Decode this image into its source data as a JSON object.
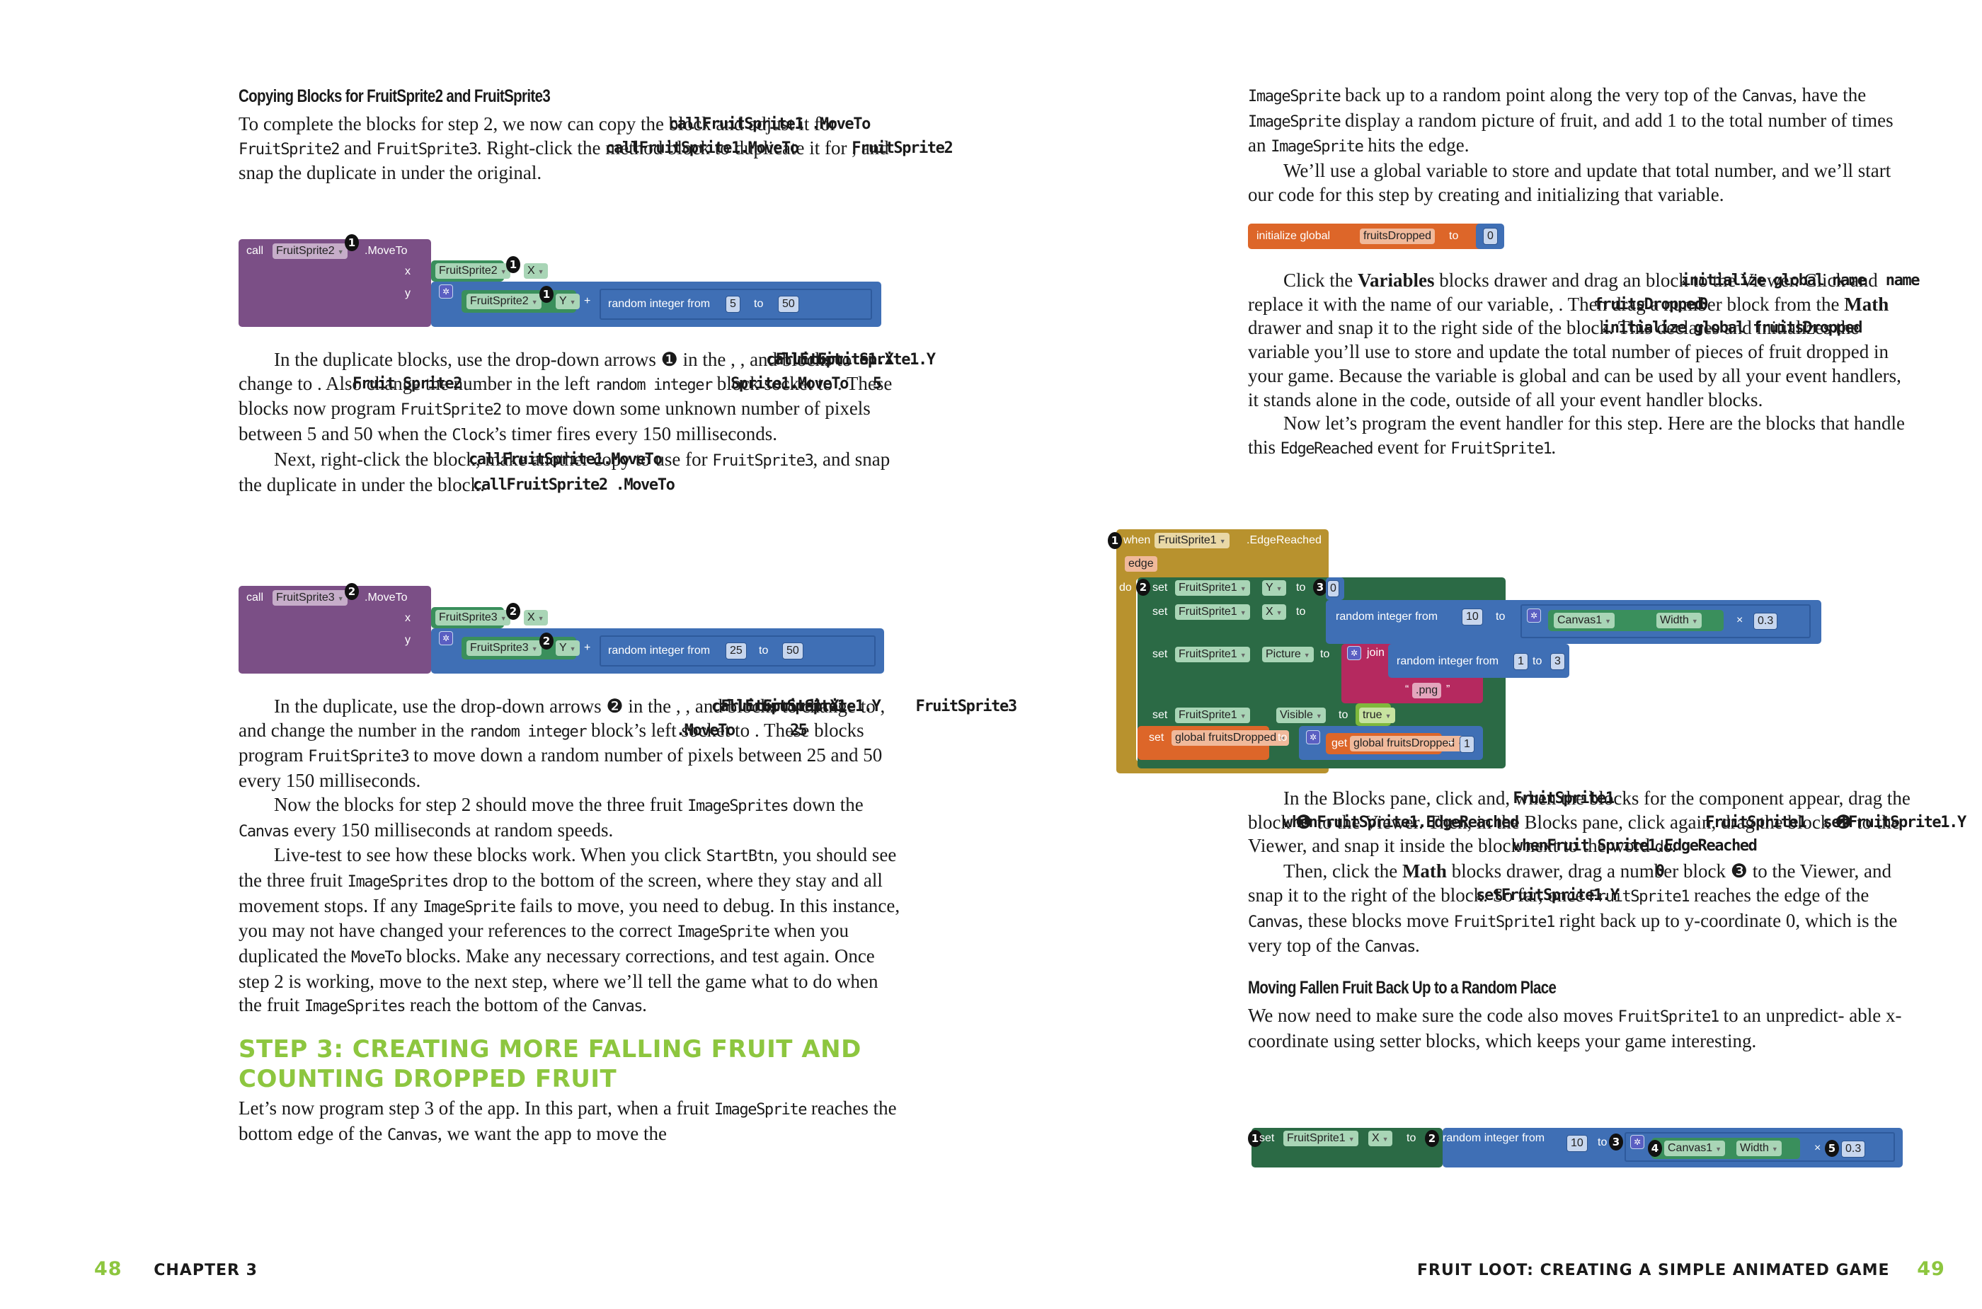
{
  "left_page": {
    "section_heading": "Copying Blocks for FruitSprite2 and FruitSprite3",
    "p1": [
      "To complete the blocks for step 2, we now can copy the ",
      "callFruitSprite1 .MoveTo",
      " block and adjust it for ",
      "FruitSprite2",
      " and ",
      "FruitSprite3",
      ". Right-click the ",
      "callFruitSprite1.MoveTo",
      " method block to duplicate it for ",
      "FruitSprite2",
      ", and snap the duplicate in under the original."
    ],
    "block1": {
      "call_label": "call",
      "component": "FruitSprite2",
      "method": ".MoveTo",
      "x_label": "x",
      "y_label": "y",
      "x_getter": {
        "component": "FruitSprite2",
        "prop": "X"
      },
      "y_getter": {
        "component": "FruitSprite2",
        "prop": "Y"
      },
      "plus": "+",
      "random_label": "random integer from",
      "to_label": "to",
      "from_value": "5",
      "to_value": "50",
      "callout": "1"
    },
    "p2": [
      "In the duplicate blocks, use the drop-down arrows ",
      "❶",
      " in the ",
      "callFruit Sprite1.MoveTo",
      ", ",
      "FruitSprite1.X",
      ", and ",
      "FruitSprite1.Y",
      " blocks to change to ",
      "Fruit Sprite2",
      ". Also change the number in the left ",
      "random integer",
      " block socket to ",
      "5",
      ". These blocks now program ",
      "FruitSprite2",
      " to move down some unknown number of pixels between 5 and 50 when the ",
      "Clock",
      "’s timer fires every 150 milliseconds."
    ],
    "p3": [
      "Next, right-click the ",
      "callFruitSprite1.MoveTo",
      " block, make another copy to use for ",
      "FruitSprite3",
      ", and snap the duplicate in under the ",
      "callFruitSprite2 .MoveTo",
      " block."
    ],
    "block2": {
      "call_label": "call",
      "component": "FruitSprite3",
      "method": ".MoveTo",
      "x_label": "x",
      "y_label": "y",
      "x_getter": {
        "component": "FruitSprite3",
        "prop": "X"
      },
      "y_getter": {
        "component": "FruitSprite3",
        "prop": "Y"
      },
      "plus": "+",
      "random_label": "random integer from",
      "to_label": "to",
      "from_value": "25",
      "to_value": "50",
      "callout": "2"
    },
    "p4": [
      "In the duplicate, use the drop-down arrows ",
      "❷",
      " in the ",
      "callFruitSprite1 .MoveTo",
      ", ",
      "FruitSprite1.X",
      ", and ",
      "FruitSprite1.Y",
      " blocks to change to ",
      "FruitSprite3",
      ", and change the number in the ",
      "random integer",
      " block’s left socket to ",
      "25",
      ". These blocks program ",
      "FruitSprite3",
      " to move down a random number of pixels between 25 and 50 every 150 milliseconds."
    ],
    "p5": [
      "Now the blocks for step 2 should move the three fruit ",
      "ImageSprites",
      " down the ",
      "Canvas",
      " every 150 milliseconds at random speeds."
    ],
    "p6": [
      "Live-test to see how these blocks work. When you click ",
      "StartBtn",
      ", you should see the three fruit ",
      "ImageSprites",
      " drop to the bottom of the screen, where they stay and all movement stops. If any ",
      "ImageSprite",
      " fails to move, you need to debug. In this instance, you may not have changed your references to the correct ",
      "ImageSprite",
      " when you duplicated the ",
      "MoveTo",
      " blocks. Make any necessary corrections, and test again. Once step 2 is working, move to the next step, where we’ll tell the game what to do when the fruit ",
      "ImageSprites",
      " reach the bottom of the ",
      "Canvas",
      "."
    ],
    "step_heading_line1": "Step 3: Creating More Falling Fruit and",
    "step_heading_line2": "Counting Dropped Fruit",
    "p7": [
      "Let’s now program step 3 of the app. In this part, when a fruit ",
      "ImageSprite",
      " reaches the bottom edge of the ",
      "Canvas",
      ", we want the app to move the"
    ],
    "footer": {
      "page_number": "48",
      "chapter": "CHAPTER 3"
    }
  },
  "right_page": {
    "p1": [
      "ImageSprite",
      " back up to a random point along the very top of the ",
      "Canvas",
      ", have the ",
      "ImageSprite",
      " display a random picture of fruit, and add 1 to the total number of times an ",
      "ImageSprite",
      " hits the edge."
    ],
    "p2": "We’ll use a global variable to store and update that total number, and we’ll start our code for this step by creating and initializing that variable.",
    "init_block": {
      "label": "initialize global",
      "name": "fruitsDropped",
      "to_label": "to",
      "value": "0"
    },
    "p3": [
      "Click the ",
      "Variables",
      " blocks drawer and drag an ",
      "initialize global name",
      " block to the Viewer. Click ",
      "name",
      " and replace it with the name of our variable, ",
      "fruitsDropped",
      ". Then drag a ",
      "0",
      " number block from the ",
      "Math",
      " drawer and snap it to the right side of the ",
      "initialize global fruitsDropped",
      " block. This declares and initializes the variable you’ll use to store and update the total number of pieces of fruit dropped in your game. Because the variable is global and can be used by all your event handlers, it stands alone in the code, outside of all your event handler blocks."
    ],
    "p4": [
      "Now let’s program the event handler for this step. Here are the blocks that handle this ",
      "EdgeReached",
      " event for ",
      "FruitSprite1",
      "."
    ],
    "event_block": {
      "when_label": "when",
      "component": "FruitSprite1",
      "event": ".EdgeReached",
      "param": "edge",
      "do_label": "do",
      "set_y": {
        "set": "set",
        "component": "FruitSprite1",
        "prop": "Y",
        "to": "to",
        "value": "0"
      },
      "set_x": {
        "set": "set",
        "component": "FruitSprite1",
        "prop": "X",
        "to": "to",
        "random_label": "random integer from",
        "from_value": "10",
        "to_label": "to",
        "canvas": "Canvas1",
        "canvas_prop": "Width",
        "times": "×",
        "factor": "0.3"
      },
      "set_picture": {
        "set": "set",
        "component": "FruitSprite1",
        "prop": "Picture",
        "to": "to",
        "join": "join",
        "random_label": "random integer from",
        "from_value": "1",
        "to_label": "to",
        "to_value": "3",
        "ext": ".png"
      },
      "set_visible": {
        "set": "set",
        "component": "FruitSprite1",
        "prop": "Visible",
        "to": "to",
        "value": "true"
      },
      "set_global": {
        "set": "set",
        "var": "global fruitsDropped",
        "to": "to",
        "get": "get",
        "get_var": "global fruitsDropped",
        "plus": "+",
        "inc": "1"
      },
      "callouts": [
        "1",
        "2",
        "3"
      ]
    },
    "p5": [
      "In the Blocks pane, click ",
      "FruitSprite1",
      " and, when the blocks for the component appear, drag the ",
      "whenFruitSprite1.EdgeReached",
      " block ",
      "❶",
      " to the Viewer. Then, in the Blocks pane, click ",
      "FruitSprite1",
      " again, drag the ",
      "setFruitSprite1.Y",
      " block ",
      "❷",
      " to the Viewer, and snap it inside the ",
      "whenFruit Sprite1.EdgeReached",
      " block next to the word ",
      "do",
      "."
    ],
    "p6": [
      "Then, click the ",
      "Math",
      " blocks drawer, drag a ",
      "0",
      " number block ",
      "❸",
      " to the Viewer, and snap it to the right of the ",
      "setFruitSprite1.Y",
      " block. So far, once ",
      "FruitSprite1",
      " reaches the edge of the ",
      "Canvas",
      ", these blocks move ",
      "FruitSprite1",
      " right back up to y-coordinate 0, which is the very top of the ",
      "Canvas",
      "."
    ],
    "section_heading": "Moving Fallen Fruit Back Up to a Random Place",
    "p7": [
      "We now need to make sure the code also moves ",
      "FruitSprite1",
      " to an unpredict- able x-coordinate using setter blocks, which keeps your game interesting."
    ],
    "setx_block": {
      "set": "set",
      "component": "FruitSprite1",
      "prop": "X",
      "to": "to",
      "random_label": "random integer from",
      "from_value": "10",
      "to_label": "to",
      "canvas": "Canvas1",
      "canvas_prop": "Width",
      "times": "×",
      "factor": "0.3",
      "callouts": [
        "1",
        "2",
        "3",
        "4",
        "5"
      ]
    },
    "footer": {
      "title": "FRUIT LOOT: CREATING A SIMPLE ANIMATED GAME",
      "page_number": "49"
    }
  },
  "colors": {
    "accent_green": "#8dc63f",
    "procedure_purple": "#7b4f86",
    "math_blue": "#3f6fb5",
    "component_green": "#3a8f5c",
    "setter_dark_green": "#2b6a45",
    "variable_orange": "#dd6629",
    "event_gold": "#b8922e",
    "text_magenta": "#b5295f",
    "logic_lime": "#7fb83c"
  }
}
